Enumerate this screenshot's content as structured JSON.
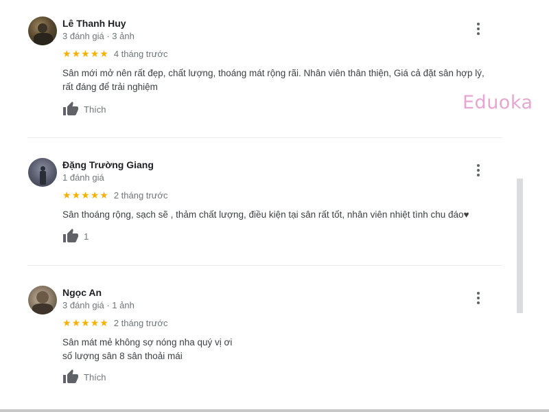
{
  "watermark": "Eduoka",
  "icons": {
    "more": "more-vert-icon",
    "like": "thumb-up-icon",
    "star": "star-icon"
  },
  "colors": {
    "star": "#f6b100",
    "watermark": "#e7a6cf",
    "secondary_text": "#70757a"
  },
  "reviews": [
    {
      "name": "Lê Thanh Huy",
      "meta": "3 đánh giá · 3 ảnh",
      "rating": 5,
      "when": "4 tháng trước",
      "text": [
        "Sân mới mở nên rất đẹp, chất lượng, thoáng mát rộng rãi. Nhân viên thân thiện, Giá cả đặt sân hợp lý,",
        "rất đáng để trải nghiệm"
      ],
      "like_label": "Thích"
    },
    {
      "name": "Đặng Trường Giang",
      "meta": "1 đánh giá",
      "rating": 5,
      "when": "2 tháng trước",
      "text": [
        "Sân thoáng rộng, sạch sẽ , thảm chất lượng, điều kiện tại sân rất tốt, nhân viên nhiệt tình chu đáo♥"
      ],
      "like_label": "1"
    },
    {
      "name": "Ngọc An",
      "meta": "3 đánh giá · 1 ảnh",
      "rating": 5,
      "when": "2 tháng trước",
      "text": [
        "Sân mát mẻ không sợ nóng nha quý vị ơi",
        "số lượng sân 8 sân thoải mái"
      ],
      "like_label": "Thích"
    }
  ]
}
